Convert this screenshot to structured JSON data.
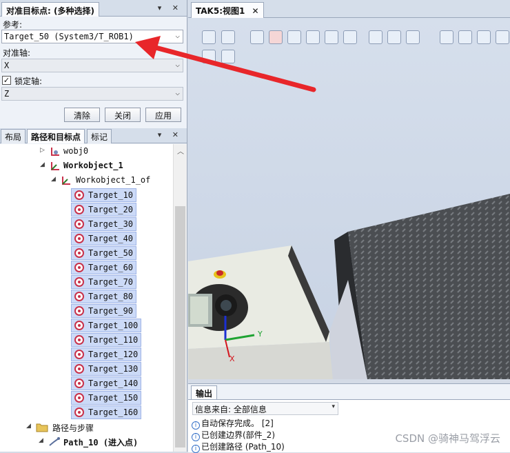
{
  "align_panel": {
    "title": "对准目标点: (多种选择)",
    "reference_label": "参考:",
    "reference_value": "Target_50 (System3/T_ROB1)",
    "align_axis_label": "对准轴:",
    "align_axis_value": "X",
    "lock_axis_label": "锁定轴:",
    "lock_axis_checked": "✓",
    "lock_axis_value": "Z",
    "buttons": {
      "clear": "清除",
      "close": "关闭",
      "apply": "应用"
    }
  },
  "explorer": {
    "tabs": [
      "布局",
      "路径和目标点",
      "标记"
    ],
    "tree": {
      "wobj0": "wobj0",
      "workobject_1": "Workobject_1",
      "workobject_1_of": "Workobject_1_of",
      "targets": [
        "Target_10",
        "Target_20",
        "Target_30",
        "Target_40",
        "Target_50",
        "Target_60",
        "Target_70",
        "Target_80",
        "Target_90",
        "Target_100",
        "Target_110",
        "Target_120",
        "Target_130",
        "Target_140",
        "Target_150",
        "Target_160"
      ],
      "paths_folder": "路径与步骤",
      "path_10": "Path_10 (进入点)"
    }
  },
  "view": {
    "tab_label": "TAK5:视图1",
    "axis_x": "X",
    "axis_y": "Y"
  },
  "output": {
    "tab_label": "输出",
    "filter": "信息来自: 全部信息",
    "messages": [
      "自动保存完成。 [2]",
      "已创建边界(部件_2)",
      "已创建路径 (Path_10)"
    ],
    "info_glyph": "i"
  },
  "watermark": "CSDN @骑神马驾浮云",
  "colors": {
    "annotation_arrow": "#e8262a",
    "target_selection": "#ccdaf7",
    "target_icon": "#c8314a"
  }
}
